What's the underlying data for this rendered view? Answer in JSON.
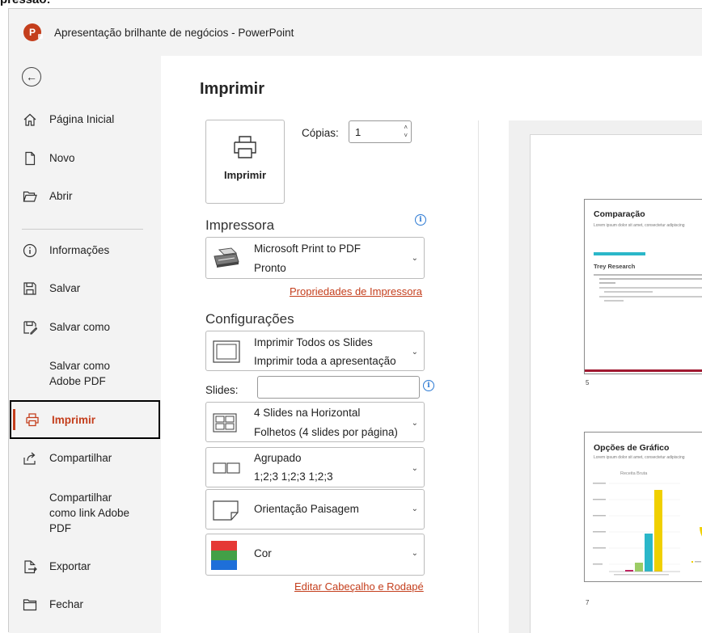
{
  "page_top_clip": "pressão:",
  "titlebar": {
    "title": "Apresentação brilhante de negócios  -  PowerPoint"
  },
  "sidebar": {
    "items": [
      {
        "label": "Página Inicial",
        "icon": "home-icon"
      },
      {
        "label": "Novo",
        "icon": "new-document-icon"
      },
      {
        "label": "Abrir",
        "icon": "open-folder-icon"
      },
      {
        "label": "Informações",
        "icon": "info-icon"
      },
      {
        "label": "Salvar",
        "icon": "save-icon"
      },
      {
        "label": "Salvar como",
        "icon": "save-as-icon"
      },
      {
        "label": "Salvar como Adobe PDF",
        "icon": ""
      },
      {
        "label": "Imprimir",
        "icon": "printer-icon",
        "selected": true
      },
      {
        "label": "Compartilhar",
        "icon": "share-icon"
      },
      {
        "label": "Compartilhar como link Adobe PDF",
        "icon": ""
      },
      {
        "label": "Exportar",
        "icon": "export-icon"
      },
      {
        "label": "Fechar",
        "icon": "close-folder-icon"
      }
    ]
  },
  "print": {
    "heading": "Imprimir",
    "print_button_label": "Imprimir",
    "copies_label": "Cópias:",
    "copies_value": "1",
    "printer_section": "Impressora",
    "printer_name": "Microsoft Print to PDF",
    "printer_status": "Pronto",
    "printer_properties_link": "Propriedades de Impressora",
    "settings_section": "Configurações",
    "range_line1": "Imprimir Todos os Slides",
    "range_line2": "Imprimir toda a apresentação",
    "slides_label": "Slides:",
    "slides_value": "",
    "layout_line1": "4 Slides na Horizontal",
    "layout_line2": "Folhetos (4 slides por página)",
    "collate_line1": "Agrupado",
    "collate_line2": "1;2;3   1;2;3   1;2;3",
    "orientation": "Orientação Paisagem",
    "color": "Cor",
    "edit_header_footer_link": "Editar Cabeçalho e Rodapé"
  },
  "preview": {
    "slide1": {
      "title": "Comparação",
      "subtitle": "Lorem ipsum dolor sit amet, consectetur adipiscing",
      "heading": "Trey Research",
      "number": "5"
    },
    "slide2": {
      "title": "Opções de Gráfico",
      "subtitle": "Lorem ipsum dolor sit amet, consectetur adipiscing",
      "chart_title": "Receita Bruta",
      "number": "7"
    }
  },
  "colors": {
    "accent": "#c43e1c",
    "info_blue": "#2b79d3",
    "teal": "#2bb7c9",
    "yellow": "#f0d000"
  }
}
